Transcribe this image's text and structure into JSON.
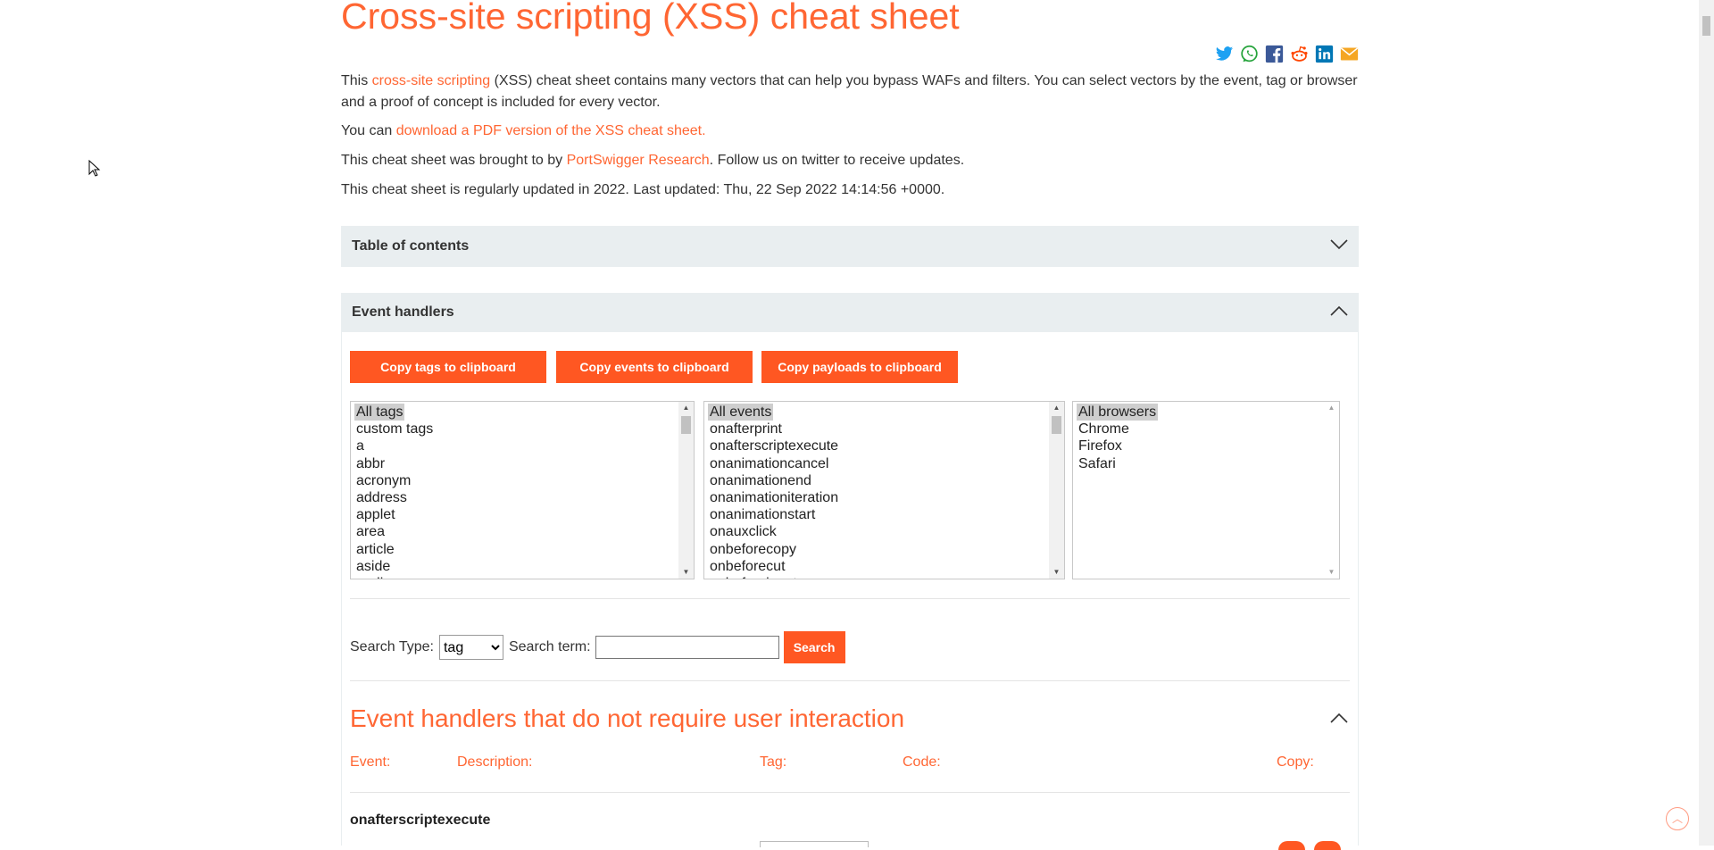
{
  "page": {
    "title": "Cross-site scripting (XSS) cheat sheet",
    "intro": {
      "prefix": "This ",
      "link": "cross-site scripting",
      "suffix": " (XSS) cheat sheet contains many vectors that can help you bypass WAFs and filters. You can select vectors by the event, tag or browser and a proof of concept is included for every vector."
    },
    "pdf": {
      "prefix": "You can ",
      "link": "download a PDF version of the XSS cheat sheet."
    },
    "brought": {
      "prefix": "This cheat sheet was brought to by ",
      "link": "PortSwigger Research",
      "suffix": ". Follow us on twitter to receive updates."
    },
    "updated": "This cheat sheet is regularly updated in 2022. Last updated: Thu, 22 Sep 2022 14:14:56 +0000."
  },
  "share": [
    "twitter-icon",
    "whatsapp-icon",
    "facebook-icon",
    "reddit-icon",
    "linkedin-icon",
    "email-icon"
  ],
  "toc": {
    "label": "Table of contents"
  },
  "event_handlers": {
    "label": "Event handlers",
    "buttons": {
      "copy_tags": "Copy tags to clipboard",
      "copy_events": "Copy events to clipboard",
      "copy_payloads": "Copy payloads to clipboard"
    },
    "tags": [
      "All tags",
      "custom tags",
      "a",
      "abbr",
      "acronym",
      "address",
      "applet",
      "area",
      "article",
      "aside",
      "audio"
    ],
    "events": [
      "All events",
      "onafterprint",
      "onafterscriptexecute",
      "onanimationcancel",
      "onanimationend",
      "onanimationiteration",
      "onanimationstart",
      "onauxclick",
      "onbeforecopy",
      "onbeforecut",
      "onbeforeinput"
    ],
    "browsers": [
      "All browsers",
      "Chrome",
      "Firefox",
      "Safari"
    ]
  },
  "search": {
    "type_label": "Search Type:",
    "type_value": "tag",
    "term_label": "Search term:",
    "term_value": "",
    "button": "Search"
  },
  "section": {
    "title": "Event handlers that do not require user interaction",
    "columns": [
      "Event:",
      "Description:",
      "Tag:",
      "Code:",
      "Copy:"
    ],
    "first_event": "onafterscriptexecute"
  },
  "colors": {
    "accent": "#ff6633",
    "button": "#ff5722",
    "panel": "#e9eef0"
  }
}
